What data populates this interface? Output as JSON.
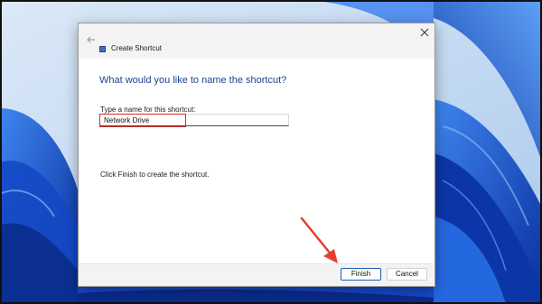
{
  "dialog": {
    "title": "Create Shortcut",
    "heading": "What would you like to name the shortcut?",
    "field_label": "Type a name for this shortcut:",
    "name_value": "Network Drive",
    "instruction": "Click Finish to create the shortcut.",
    "finish_label": "Finish",
    "cancel_label": "Cancel"
  },
  "icons": {
    "back": "back-arrow-icon",
    "app": "shortcut-app-icon",
    "close": "close-icon",
    "annotation": "red-arrow-annotation"
  },
  "colors": {
    "heading": "#1f3f95",
    "highlight": "#d62b2b",
    "annotation_arrow": "#e3402f",
    "wallpaper_blue": "#1f5bd6",
    "wallpaper_light": "#bcd8f5"
  }
}
